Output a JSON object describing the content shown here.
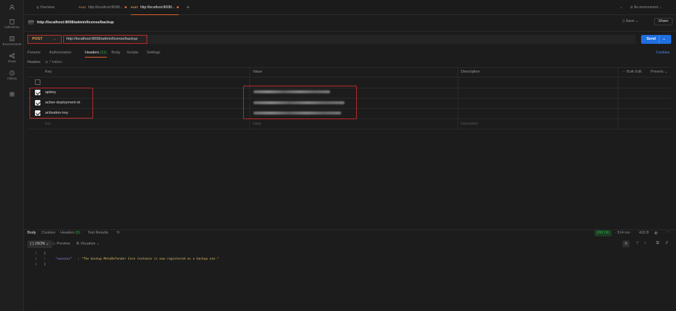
{
  "rail": [
    {
      "label": "",
      "icon": "user-icon"
    },
    {
      "label": "Collections",
      "icon": "trash-icon"
    },
    {
      "label": "Environments",
      "icon": "environment-icon"
    },
    {
      "label": "Flows",
      "icon": "flows-icon"
    },
    {
      "label": "History",
      "icon": "history-icon"
    },
    {
      "label": "",
      "icon": "grid-icon"
    }
  ],
  "tabs": [
    {
      "label": "Overview",
      "method": ""
    },
    {
      "label": "http://localhost:8008/...",
      "method": "POST"
    },
    {
      "label": "http://localhost:8008/...",
      "method": "POST"
    }
  ],
  "env": {
    "label": "No environment"
  },
  "request": {
    "title": "http://localhost:8008/admin/license/backup",
    "save": "Save",
    "share": "Share",
    "method": "POST",
    "url": "http://localhost:8008/admin/license/backup",
    "send": "Send",
    "cookies": "Cookies"
  },
  "subtabs": {
    "params": "Params",
    "authorization": "Authorization",
    "headers": "Headers",
    "headers_count": "(11)",
    "body": "Body",
    "scripts": "Scripts",
    "settings": "Settings"
  },
  "headers_section": {
    "label": "Headers",
    "hidden": "7 hidden",
    "col_key": "Key",
    "col_value": "Value",
    "col_desc": "Description",
    "bulk_edit": "Bulk Edit",
    "presets": "Presets",
    "rows": [
      {
        "key": "apikey",
        "checked": true
      },
      {
        "key": "active-deployment-id",
        "checked": true
      },
      {
        "key": "activation-key",
        "checked": true
      }
    ],
    "ph_key": "Key",
    "ph_value": "Value",
    "ph_desc": "Description"
  },
  "response": {
    "tabs": {
      "body": "Body",
      "cookies": "Cookies",
      "headers": "Headers",
      "headers_count": "(9)",
      "tests": "Test Results"
    },
    "status": "200 OK",
    "time": "514 ms",
    "size": "418 B",
    "format": "JSON",
    "preview": "Preview",
    "visualize": "Visualize",
    "lines": [
      "1",
      "2",
      "3"
    ],
    "open_brace": "{",
    "json_key": "\"success\"",
    "json_value": "\"The backup MetaDefender Core instance is now registered as a backup one.\"",
    "close_brace": "}"
  },
  "colors": {
    "accent": "#e8642c",
    "send": "#1f6fe0",
    "ok": "#2db34a",
    "highlight": "#c02b2b"
  }
}
